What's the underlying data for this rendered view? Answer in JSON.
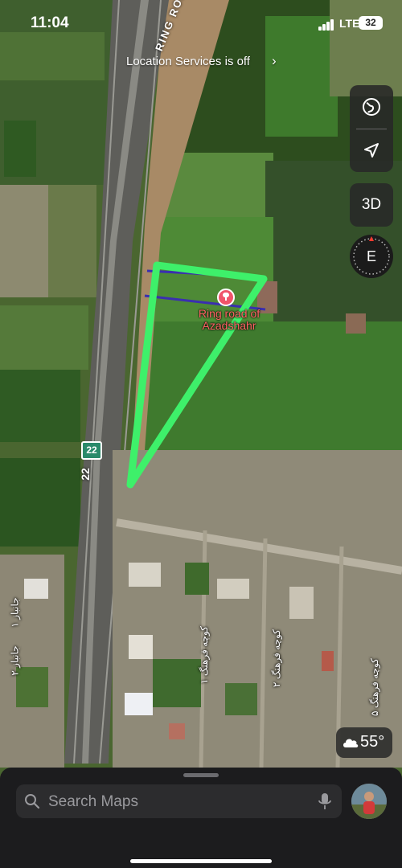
{
  "status_bar": {
    "time": "11:04",
    "network": "LTE",
    "battery": "32"
  },
  "location_banner": {
    "text": "Location Services is off",
    "chevron": "›"
  },
  "map_controls": {
    "globe_icon": "globe-icon",
    "location_icon": "location-arrow-icon",
    "mode_label": "3D",
    "compass_heading": "E"
  },
  "map": {
    "route_label_line1": "Ring road of",
    "route_label_line2": "Azadshahr",
    "road_shield": "22",
    "road_number": "22",
    "ring_road_label": "RING ROAD",
    "street_labels": [
      "جانباز ۱",
      "جانباز ۲",
      "کوچه فرهنگ ۱",
      "کوچه فرهنگ ۲",
      "کوچه فرهنگ ۵"
    ],
    "drawn_shape_color": "#3ef06a",
    "drawn_line_color": "#3a2fb0",
    "pin_color": "#f0546a"
  },
  "weather": {
    "temperature": "55°",
    "icon": "cloud-icon"
  },
  "search": {
    "placeholder": "Search Maps"
  }
}
